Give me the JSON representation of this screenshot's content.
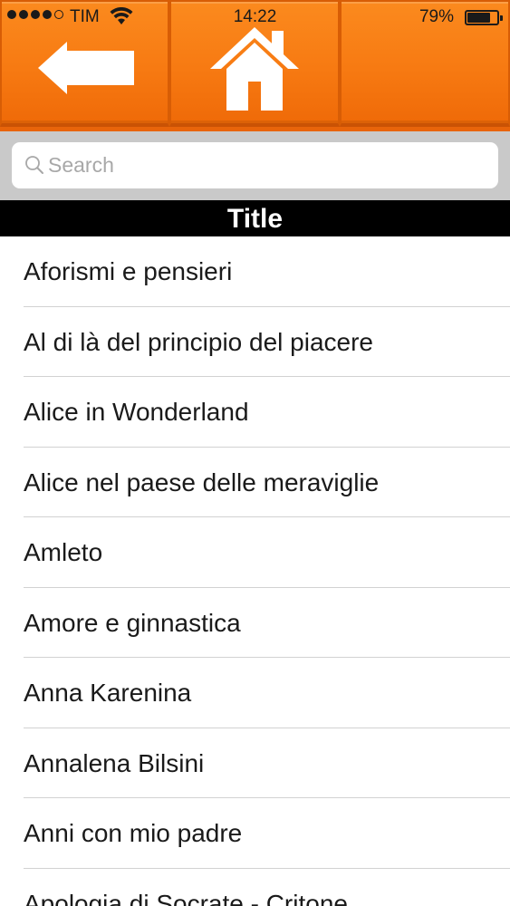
{
  "status_bar": {
    "carrier": "TIM",
    "time": "14:22",
    "battery_percent": "79%",
    "battery_level": 0.79,
    "signal_bars_filled": 4,
    "signal_bars_total": 5
  },
  "toolbar": {
    "back_icon": "back-arrow-icon",
    "home_icon": "home-icon",
    "accent_color": "#f77a12"
  },
  "search": {
    "placeholder": "Search",
    "value": ""
  },
  "section": {
    "title": "Title"
  },
  "list": {
    "items": [
      {
        "label": "Aforismi e pensieri"
      },
      {
        "label": "Al di là del principio del piacere"
      },
      {
        "label": "Alice in Wonderland"
      },
      {
        "label": "Alice nel paese delle meraviglie"
      },
      {
        "label": "Amleto"
      },
      {
        "label": "Amore e ginnastica"
      },
      {
        "label": "Anna Karenina"
      },
      {
        "label": "Annalena Bilsini"
      },
      {
        "label": "Anni con mio padre"
      },
      {
        "label": "Apologia di Socrate - Critone"
      }
    ]
  }
}
